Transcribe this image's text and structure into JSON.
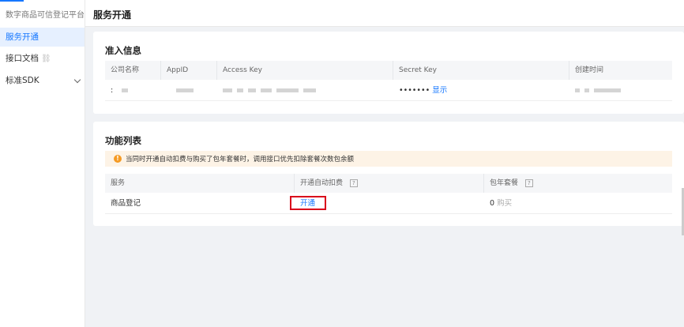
{
  "sidebar": {
    "brand": "数字商品可信登记平台",
    "items": [
      {
        "label": "服务开通"
      },
      {
        "label": "接口文档"
      },
      {
        "label": "标准SDK"
      }
    ]
  },
  "header": {
    "title": "服务开通"
  },
  "access_info": {
    "title": "准入信息",
    "columns": [
      "公司名称",
      "AppID",
      "Access Key",
      "Secret Key",
      "创建时间"
    ],
    "row": {
      "company": ":",
      "secret_masked": "•••••••",
      "show_label": "显示"
    }
  },
  "features": {
    "title": "功能列表",
    "notice": "当同时开通自动扣费与购买了包年套餐时，调用接口优先扣除套餐次数包余额",
    "columns": [
      "服务",
      "开通自动扣费",
      "包年套餐"
    ],
    "help_glyph": "?",
    "rows": [
      {
        "service": "商品登记",
        "action": "开通",
        "package_count": "0",
        "buy": "购买"
      }
    ]
  },
  "colors": {
    "accent": "#1677ff",
    "warning": "#f59a23",
    "highlight": "#d9001b"
  },
  "icons": {
    "link": "link-icon",
    "chevron": "chevron-down-icon",
    "warning": "warning-icon",
    "help": "help-icon"
  }
}
